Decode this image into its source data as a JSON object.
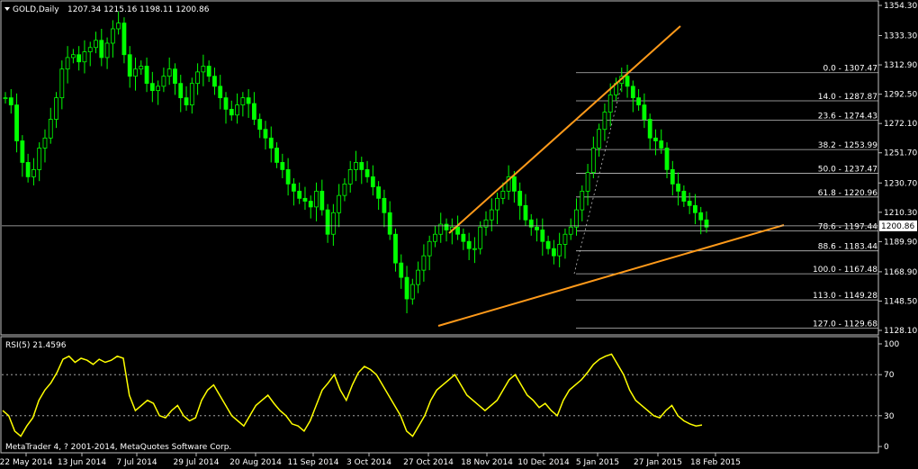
{
  "window": {
    "symbol_label": "GOLD,Daily",
    "ohlc": "1207.34 1215.16 1198.11 1200.86",
    "copyright": "MetaTrader 4, ? 2001-2014, MetaQuotes Software Corp."
  },
  "colors": {
    "background": "#000000",
    "frame": "#c0c0c0",
    "candles": "#00ff00",
    "fib_lines": "#c0c0c0",
    "trendlines": "#ff9a1a",
    "rsi": "#ffff00",
    "bid_line": "#c0c0c0"
  },
  "price_axis": {
    "labels": [
      "1354.30",
      "1333.30",
      "1312.90",
      "1292.50",
      "1272.10",
      "1251.70",
      "1230.70",
      "1210.30",
      "1189.90",
      "1168.90",
      "1148.50",
      "1128.10"
    ],
    "current_price": "1200.86"
  },
  "date_axis": {
    "labels": [
      "22 May 2014",
      "13 Jun 2014",
      "7 Jul 2014",
      "29 Jul 2014",
      "20 Aug 2014",
      "11 Sep 2014",
      "3 Oct 2014",
      "27 Oct 2014",
      "18 Nov 2014",
      "10 Dec 2014",
      "5 Jan 2015",
      "27 Jan 2015",
      "18 Feb 2015"
    ]
  },
  "fibonacci": [
    {
      "label": "0.0 - 1307.47",
      "price": 1307.47
    },
    {
      "label": "14.0 - 1287.87",
      "price": 1287.87
    },
    {
      "label": "23.6 - 1274.43",
      "price": 1274.43
    },
    {
      "label": "38.2 - 1253.99",
      "price": 1253.99
    },
    {
      "label": "50.0 - 1237.47",
      "price": 1237.47
    },
    {
      "label": "61.8 - 1220.96",
      "price": 1220.96
    },
    {
      "label": "78.6 - 1197.44",
      "price": 1197.44
    },
    {
      "label": "88.6 - 1183.44",
      "price": 1183.44
    },
    {
      "label": "100.0 - 1167.48",
      "price": 1167.48
    },
    {
      "label": "113.0 - 1149.28",
      "price": 1149.28
    },
    {
      "label": "127.0 - 1129.68",
      "price": 1129.68
    }
  ],
  "rsi": {
    "title": "RSI(5) 21.4596",
    "axis_labels": [
      "100",
      "70",
      "30",
      "0"
    ],
    "levels": [
      70,
      30
    ]
  },
  "chart_data": {
    "type": "candlestick",
    "title": "GOLD,Daily",
    "price_range": [
      1120,
      1360
    ],
    "close_series": [
      1290,
      1285,
      1260,
      1245,
      1235,
      1240,
      1255,
      1262,
      1275,
      1290,
      1310,
      1318,
      1320,
      1315,
      1322,
      1325,
      1330,
      1318,
      1328,
      1338,
      1342,
      1320,
      1305,
      1310,
      1312,
      1300,
      1295,
      1298,
      1305,
      1310,
      1300,
      1290,
      1285,
      1300,
      1308,
      1312,
      1305,
      1298,
      1290,
      1282,
      1278,
      1285,
      1290,
      1286,
      1275,
      1268,
      1262,
      1255,
      1245,
      1240,
      1230,
      1225,
      1220,
      1218,
      1214,
      1225,
      1212,
      1195,
      1210,
      1222,
      1230,
      1240,
      1245,
      1240,
      1235,
      1228,
      1220,
      1210,
      1195,
      1175,
      1165,
      1150,
      1160,
      1170,
      1180,
      1190,
      1195,
      1202,
      1198,
      1200,
      1195,
      1190,
      1185,
      1185,
      1200,
      1205,
      1212,
      1220,
      1225,
      1235,
      1225,
      1215,
      1205,
      1200,
      1198,
      1190,
      1185,
      1180,
      1188,
      1195,
      1200,
      1212,
      1225,
      1238,
      1255,
      1268,
      1280,
      1292,
      1300,
      1305,
      1298,
      1290,
      1285,
      1275,
      1262,
      1260,
      1255,
      1240,
      1230,
      1225,
      1218,
      1215,
      1210,
      1205,
      1200
    ],
    "rsi_series": [
      35,
      30,
      15,
      10,
      20,
      28,
      45,
      55,
      62,
      72,
      85,
      88,
      82,
      86,
      84,
      80,
      85,
      82,
      84,
      88,
      86,
      50,
      35,
      40,
      45,
      42,
      30,
      28,
      35,
      40,
      30,
      25,
      28,
      45,
      55,
      60,
      50,
      40,
      30,
      25,
      20,
      30,
      40,
      45,
      50,
      42,
      35,
      30,
      22,
      20,
      15,
      25,
      40,
      55,
      62,
      70,
      55,
      45,
      60,
      72,
      78,
      75,
      70,
      60,
      50,
      40,
      30,
      15,
      10,
      20,
      30,
      45,
      55,
      60,
      65,
      70,
      60,
      50,
      45,
      40,
      35,
      40,
      45,
      55,
      65,
      70,
      60,
      50,
      45,
      38,
      42,
      35,
      30,
      45,
      55,
      60,
      65,
      72,
      80,
      85,
      88,
      90,
      80,
      70,
      55,
      45,
      40,
      35,
      30,
      28,
      35,
      40,
      30,
      25,
      22,
      20,
      21
    ]
  }
}
